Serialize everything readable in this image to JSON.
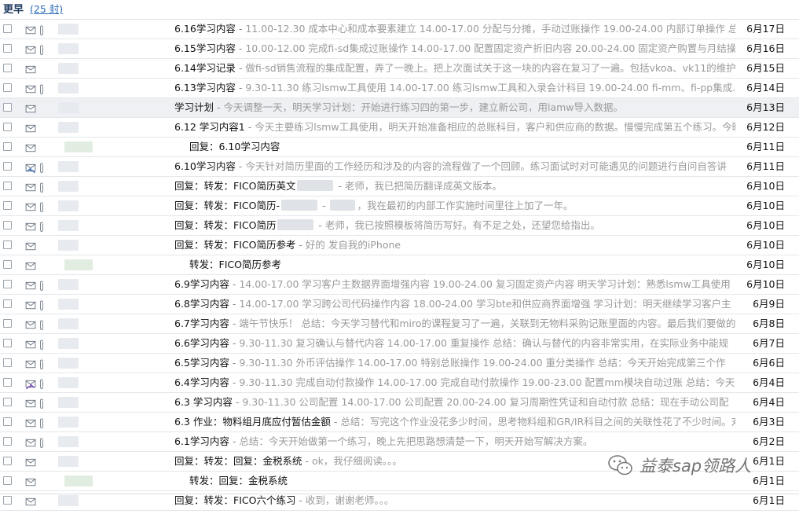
{
  "group": {
    "title": "更早",
    "count": "(25 封)"
  },
  "rows": [
    {
      "subject": "6.16学习内容",
      "preview": "11.00-12.30 成本中心和成本要素建立 14.00-17.00 分配与分摊，手动过账操作 19.00-24.00 内部订单操作 总",
      "date": "6月17日",
      "clip": true,
      "indent": false,
      "icon": "envelope-icon"
    },
    {
      "subject": "6.15学习内容",
      "preview": "10.00-12.00 完成fi-sd集成过账操作 14.00-17.00 配置固定资产折旧内容 20.00-24.00 固定资产购置与月结操",
      "date": "6月16日",
      "clip": true,
      "indent": false,
      "icon": "envelope-icon"
    },
    {
      "subject": "6.14学习记录",
      "preview": "做fi-sd销售流程的集成配置，弄了一晚上。把上次面试关于这一块的内容在复习了一遍。包括vkoa、vk11的维护",
      "date": "6月15日",
      "clip": false,
      "indent": false,
      "icon": "envelope-icon"
    },
    {
      "subject": "6.13学习内容",
      "preview": "9.30-11.30 练习lsmw工具使用 14.00-17.00 练习lsmw工具和入录会计科目 19.00-24.00 fi-mm、fi-pp集成...",
      "date": "6月14日",
      "clip": true,
      "indent": false,
      "icon": "envelope-icon"
    },
    {
      "subject": "学习计划",
      "preview": "今天调整一天，明天学习计划：开始进行练习四的第一步，建立新公司，用lamw导入数据。",
      "date": "6月13日",
      "clip": false,
      "indent": false,
      "icon": "envelope-icon",
      "highlight": true
    },
    {
      "subject": "6.12 学习内容1",
      "preview": "今天主要练习lsmw工具使用，明天开始准备相应的总账科目，客户和供应商的数据。慢慢完成第五个练习。今晚",
      "date": "6月12日",
      "clip": false,
      "indent": false,
      "icon": "envelope-icon"
    },
    {
      "subject": "回复：6.10学习内容",
      "preview": "",
      "date": "6月11日",
      "clip": false,
      "indent": true,
      "icon": "envelope-icon"
    },
    {
      "subject": "6.10学习内容",
      "preview": "今天针对简历里面的工作经历和涉及的内容的流程做了一个回顾。练习面试时对可能遇见的问题进行自问自答讲",
      "date": "6月11日",
      "clip": true,
      "indent": false,
      "icon": "replied-icon"
    },
    {
      "subject": "回复：转发：FICO简历英文",
      "preview": "老师，我已把简历翻译成英文版本。",
      "date": "6月10日",
      "clip": true,
      "indent": false,
      "icon": "envelope-icon",
      "blur_before_sep": true
    },
    {
      "subject": "回复：转发：FICO简历-",
      "preview": "，我在最初的内部工作实施时间里往上加了一年。",
      "date": "6月10日",
      "clip": true,
      "indent": false,
      "icon": "envelope-icon",
      "blur_before_sep": true,
      "blur_after_sep": true
    },
    {
      "subject": "回复：转发：FICO简历",
      "preview": "老师，我已按照模板将简历写好。有不足之处，还望您给指出。",
      "date": "6月10日",
      "clip": true,
      "indent": false,
      "icon": "envelope-icon",
      "blur_before_sep": true
    },
    {
      "subject": "回复：转发：FICO简历参考",
      "preview": "好的 发自我的iPhone",
      "date": "6月10日",
      "clip": false,
      "indent": false,
      "icon": "envelope-icon"
    },
    {
      "subject": "转发：FICO简历参考",
      "preview": "",
      "date": "6月10日",
      "clip": false,
      "indent": true,
      "icon": "envelope-icon"
    },
    {
      "subject": "6.9学习内容",
      "preview": "14.00-17.00 学习客户主数据界面增强内容 19.00-24.00 复习固定资产内容 明天学习计划：熟悉lsmw工具使用",
      "date": "6月10日",
      "clip": true,
      "indent": false,
      "icon": "envelope-icon"
    },
    {
      "subject": "6.8学习内容",
      "preview": "14.00-17.00 学习跨公司代码操作内容 18.00-24.00 学习bte和供应商界面增强 学习计划：明天继续学习客户主",
      "date": "6月9日",
      "clip": true,
      "indent": false,
      "icon": "envelope-icon"
    },
    {
      "subject": "6.7学习内容",
      "preview": "端午节快乐！ 总结：今天学习替代和miro的课程复习了一遍，关联到无物料采购记账里面的内容。最后我们要做的",
      "date": "6月8日",
      "clip": true,
      "indent": false,
      "icon": "envelope-icon"
    },
    {
      "subject": "6.6学习内容",
      "preview": "9.30-11.30 复习确认与替代内容 14.00-17.00 重复操作 总结：确认与替代的内容非常实用，在实际业务中能规",
      "date": "6月7日",
      "clip": true,
      "indent": false,
      "icon": "envelope-icon"
    },
    {
      "subject": "6.5学习内容",
      "preview": "9.30-11.30 外币评估操作 14.00-17.00 特别总账操作 19.00-24.00 重分类操作 总结：今天开始完成第三个作",
      "date": "6月6日",
      "clip": true,
      "indent": false,
      "icon": "envelope-icon"
    },
    {
      "subject": "6.4学习内容",
      "preview": "9.30-11.30 完成自动付款操作 14.00-17.00 完成自动付款操作 19.00-23.00 配置mm模块自动过账 总结：今天",
      "date": "6月4日",
      "clip": true,
      "indent": false,
      "icon": "forwarded-icon"
    },
    {
      "subject": "6.3 学习内容",
      "preview": "9.30-11.30 公司配置 14.00-17.00 公司配置 20.00-24.00 复习周期性凭证和自动付款 总结：现在手动公司配",
      "date": "6月4日",
      "clip": true,
      "indent": false,
      "icon": "envelope-icon"
    },
    {
      "subject": "6.3 作业：物料组月底应付暂估金额",
      "preview": "总结：写完这个作业没花多少时间，思考物料组和GR/IR科目之间的关联性花了不少时间。对...",
      "date": "6月3日",
      "clip": true,
      "indent": false,
      "icon": "envelope-icon"
    },
    {
      "subject": "6.1学习内容",
      "preview": "总结：今天开始做第一个练习，晚上先把思路想清楚一下，明天开始写解决方案。",
      "date": "6月2日",
      "clip": true,
      "indent": false,
      "icon": "envelope-icon"
    },
    {
      "subject": "回复：转发：回复：金税系统",
      "preview": "ok，我仔细阅读。。。",
      "date": "6月1日",
      "clip": false,
      "indent": false,
      "icon": "envelope-icon"
    },
    {
      "subject": "转发：回复：金税系统",
      "preview": "",
      "date": "6月1日",
      "clip": false,
      "indent": true,
      "icon": "envelope-icon"
    },
    {
      "subject": "回复：转发：FICO六个练习",
      "preview": "收到，谢谢老师。。。",
      "date": "6月1日",
      "clip": false,
      "indent": false,
      "icon": "envelope-icon"
    }
  ],
  "watermark": {
    "text": "益泰sap领路人",
    "icon": "wechat-icon"
  },
  "colors": {
    "header_text": "#1f3a60",
    "count_link": "#2a6ab8",
    "preview_text": "#9a9a9a",
    "row_border": "#e4e7eb",
    "highlight_row": "#eef0f3"
  }
}
